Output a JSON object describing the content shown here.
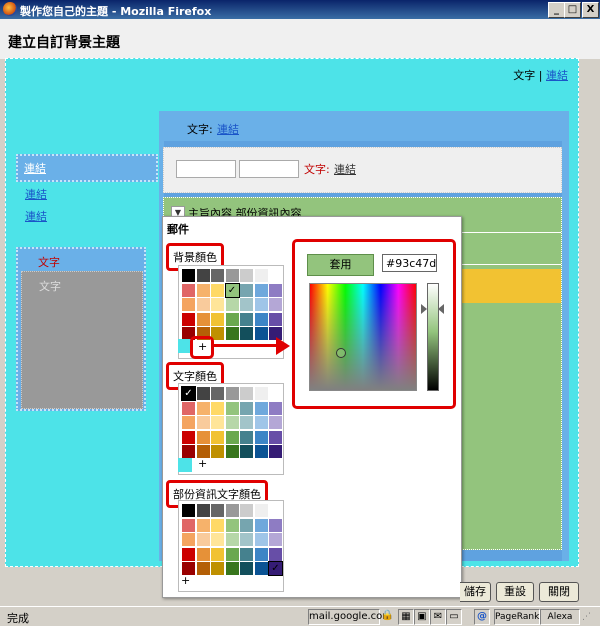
{
  "window": {
    "title": "製作您自己的主題 - Mozilla Firefox",
    "min": "_",
    "max": "□",
    "close": "X"
  },
  "page_title": "建立自訂背景主題",
  "preview": {
    "top_text": "文字",
    "top_sep": "|",
    "top_link": "連結",
    "side_links": [
      "連結",
      "連結",
      "連結"
    ],
    "side_box_text": "文字",
    "side_box_gray_text": "文字",
    "frame_text": "文字:",
    "frame_link": "連結",
    "nav_text": "文字:",
    "nav_link": "連結",
    "thread_text": "主旨內容 部份資訊內容"
  },
  "popup": {
    "title": "郵件",
    "background_label": "背景顏色",
    "text_label": "文字顏色",
    "snippet_label": "部份資訊文字顏色",
    "plus": "+",
    "check": "✓",
    "apply_label": "套用",
    "hex_value": "#93c47d"
  },
  "buttons": {
    "save": "儲存",
    "reset": "重設",
    "close": "關閉"
  },
  "status": {
    "left": "完成",
    "domain": "mail.google.com",
    "pagerank": "PageRank",
    "alexa": "Alexa"
  },
  "colors": {
    "preview_bg": "#4de3e8",
    "main_panel": "#93c47d",
    "frame": "#6ab0e8",
    "highlight": "#e00000",
    "selected": "#93c47d"
  }
}
